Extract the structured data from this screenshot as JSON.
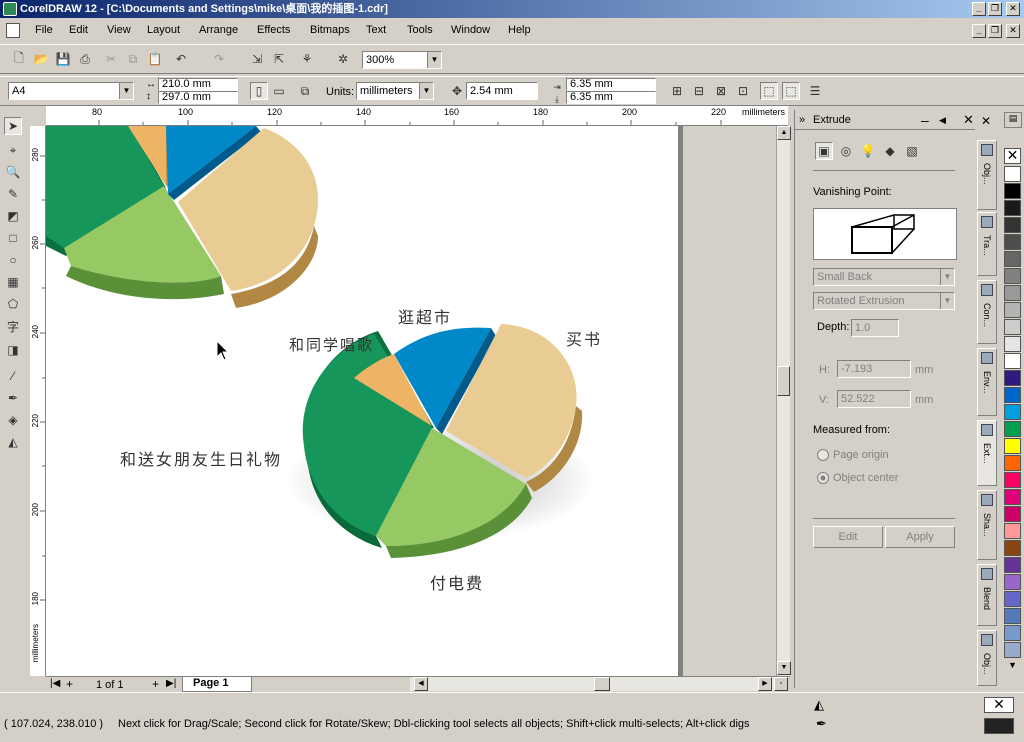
{
  "window": {
    "title": "CorelDRAW 12 - [C:\\Documents and Settings\\mike\\桌面\\我的插图-1.cdr]",
    "controls": [
      "_",
      "❐",
      "✕"
    ]
  },
  "menu": [
    "File",
    "Edit",
    "View",
    "Layout",
    "Arrange",
    "Effects",
    "Bitmaps",
    "Text",
    "Tools",
    "Window",
    "Help"
  ],
  "standard_toolbar": {
    "zoom": "300%"
  },
  "property_bar": {
    "page_size": "A4",
    "width": "210.0 mm",
    "height": "297.0 mm",
    "units_label": "Units:",
    "units": "millimeters",
    "nudge": "2.54 mm",
    "dup_x": "6.35 mm",
    "dup_y": "6.35 mm"
  },
  "rulers": {
    "h_ticks": [
      "80",
      "100",
      "120",
      "140",
      "160",
      "180",
      "200",
      "220"
    ],
    "h_unit": "millimeters",
    "v_ticks": [
      "280",
      "260",
      "240",
      "220",
      "200",
      "180"
    ],
    "v_unit": "millimeters"
  },
  "canvas": {
    "labels": {
      "shopping": "逛超市",
      "books": "买书",
      "singing": "和同学唱歌",
      "gift": "和送女朋友生日礼物",
      "bills": "付电费"
    },
    "colors": {
      "blue": "#0088c8",
      "tan": "#e8cc94",
      "lightgreen": "#96c864",
      "green": "#16965a",
      "orange": "#ecb464"
    }
  },
  "page_nav": {
    "counter": "1 of 1",
    "tab": "Page 1"
  },
  "docker": {
    "title": "Extrude",
    "vanishing_point_label": "Vanishing Point:",
    "type": "Small Back",
    "vp_mode": "Rotated Extrusion",
    "depth_label": "Depth:",
    "depth": "1.0",
    "h_label": "H:",
    "h_value": "-7.193",
    "v_label": "V:",
    "v_value": "52.522",
    "unit": "mm",
    "measured_from": "Measured from:",
    "page_origin": "Page origin",
    "object_center": "Object center",
    "edit": "Edit",
    "apply": "Apply"
  },
  "side_tabs": [
    "Obj...",
    "Tra...",
    "Con...",
    "Env...",
    "Ext...",
    "Sha...",
    "Blend",
    "Obj..."
  ],
  "palette": [
    "#ffffff",
    "#000000",
    "#1a1a1a",
    "#333333",
    "#4d4d4d",
    "#666666",
    "#808080",
    "#999999",
    "#b3b3b3",
    "#cccccc",
    "#e6e6e6",
    "#ffffff",
    "#2e1a80",
    "#0066cc",
    "#00a0e0",
    "#00a050",
    "#ffff00",
    "#ff6600",
    "#ff0066",
    "#e0007a",
    "#cc0066",
    "#ff9999",
    "#8b4513",
    "#663399",
    "#9966cc",
    "#6666cc",
    "#5577bb",
    "#7799cc",
    "#99aacc"
  ],
  "status": {
    "coords": "( 107.024, 238.010 )",
    "hint": "Next click for Drag/Scale; Second click for Rotate/Skew; Dbl-clicking tool selects all objects; Shift+click multi-selects; Alt+click digs"
  }
}
